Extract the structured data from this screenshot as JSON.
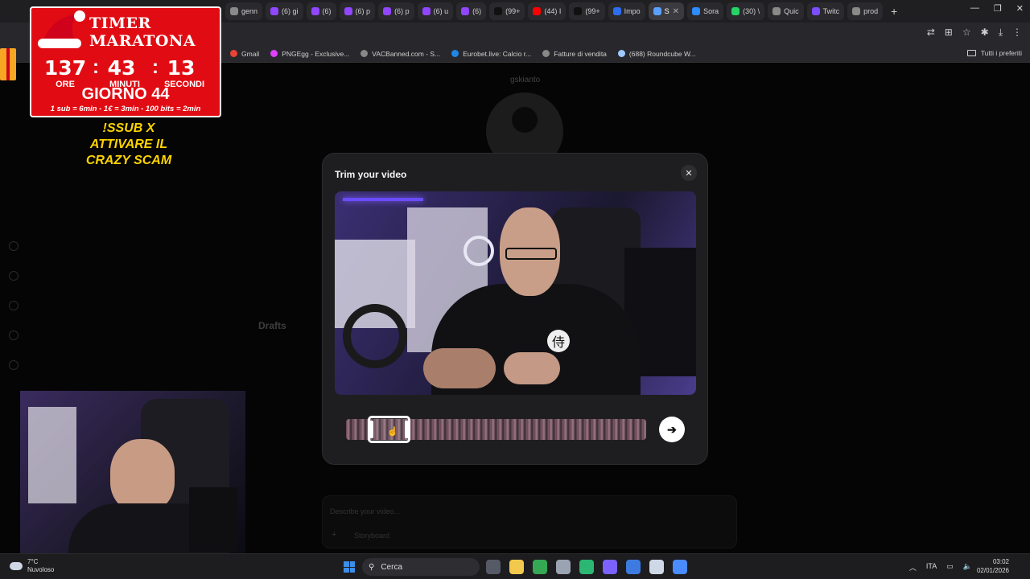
{
  "browser": {
    "tabs": [
      {
        "label": "genn",
        "color": "#8a8a8a"
      },
      {
        "label": "(6) gi",
        "color": "#9146ff"
      },
      {
        "label": "(6)",
        "color": "#9146ff"
      },
      {
        "label": "(6) p",
        "color": "#9146ff"
      },
      {
        "label": "(6) p",
        "color": "#9146ff"
      },
      {
        "label": "(6) u",
        "color": "#9146ff"
      },
      {
        "label": "(6)",
        "color": "#9146ff"
      },
      {
        "label": "(99+",
        "color": "#111111"
      },
      {
        "label": "(44) I",
        "color": "#ff0000"
      },
      {
        "label": "(99+",
        "color": "#111111"
      },
      {
        "label": "Impo",
        "color": "#2d6ef0"
      },
      {
        "label": "S",
        "color": "#5aa0ff",
        "active": true
      },
      {
        "label": "Sora",
        "color": "#2d8cff"
      },
      {
        "label": "(30) \\",
        "color": "#25d366"
      },
      {
        "label": "Quic",
        "color": "#8a8a8a"
      },
      {
        "label": "Twitc",
        "color": "#7c4dff"
      },
      {
        "label": "prod",
        "color": "#8a8a8a"
      }
    ],
    "close_tab_glyph": "✕",
    "new_tab_glyph": "+",
    "window_controls": [
      "—",
      "❐",
      "✕"
    ],
    "bookmarks": [
      {
        "label": "Gmail",
        "color": "#ea4335"
      },
      {
        "label": "PNGEgg - Exclusive...",
        "color": "#e040fb"
      },
      {
        "label": "VACBanned.com - S...",
        "color": "#888888"
      },
      {
        "label": "Eurobet.live: Calcio r...",
        "color": "#1e88e5"
      },
      {
        "label": "Fatture di vendita",
        "color": "#888888"
      },
      {
        "label": "(688) Roundcube W...",
        "color": "#9ec9ff"
      }
    ],
    "bookmarks_right": "Tutti i preferiti"
  },
  "page": {
    "profile_name": "gskianto",
    "drafts_label": "Drafts",
    "describe_placeholder": "Describe your video...",
    "storyboard_label": "Storyboard",
    "plus_glyph": "+"
  },
  "overlay": {
    "title": "TIMER MARATONA",
    "hours": "137",
    "minutes": "43",
    "seconds": "13",
    "hours_label": "ORE",
    "minutes_label": "MINUTI",
    "seconds_label": "SECONDI",
    "day": "GIORNO 44",
    "rate": "1 sub = 6min - 1€ = 3min - 100 bits = 2min",
    "command_line1": "!SSUB X",
    "command_line2": "ATTIVARE IL",
    "command_line3": "CRAZY SCAM",
    "colon": ":"
  },
  "modal": {
    "title": "Trim your video",
    "close_glyph": "✕",
    "next_glyph": "➔",
    "logo_glyph": "侍"
  },
  "taskbar": {
    "temperature": "7°C",
    "weather": "Nuvoloso",
    "search_label": "Cerca",
    "language": "ITA",
    "time": "03:02",
    "date": "02/01/2026",
    "tray_up_glyph": "︿",
    "app_colors": [
      "#555a66",
      "#f2c94c",
      "#34a853",
      "#9aa3b2",
      "#2bb673",
      "#7b61ff",
      "#3e7be0",
      "#cfd8e6",
      "#4a8bff"
    ]
  }
}
